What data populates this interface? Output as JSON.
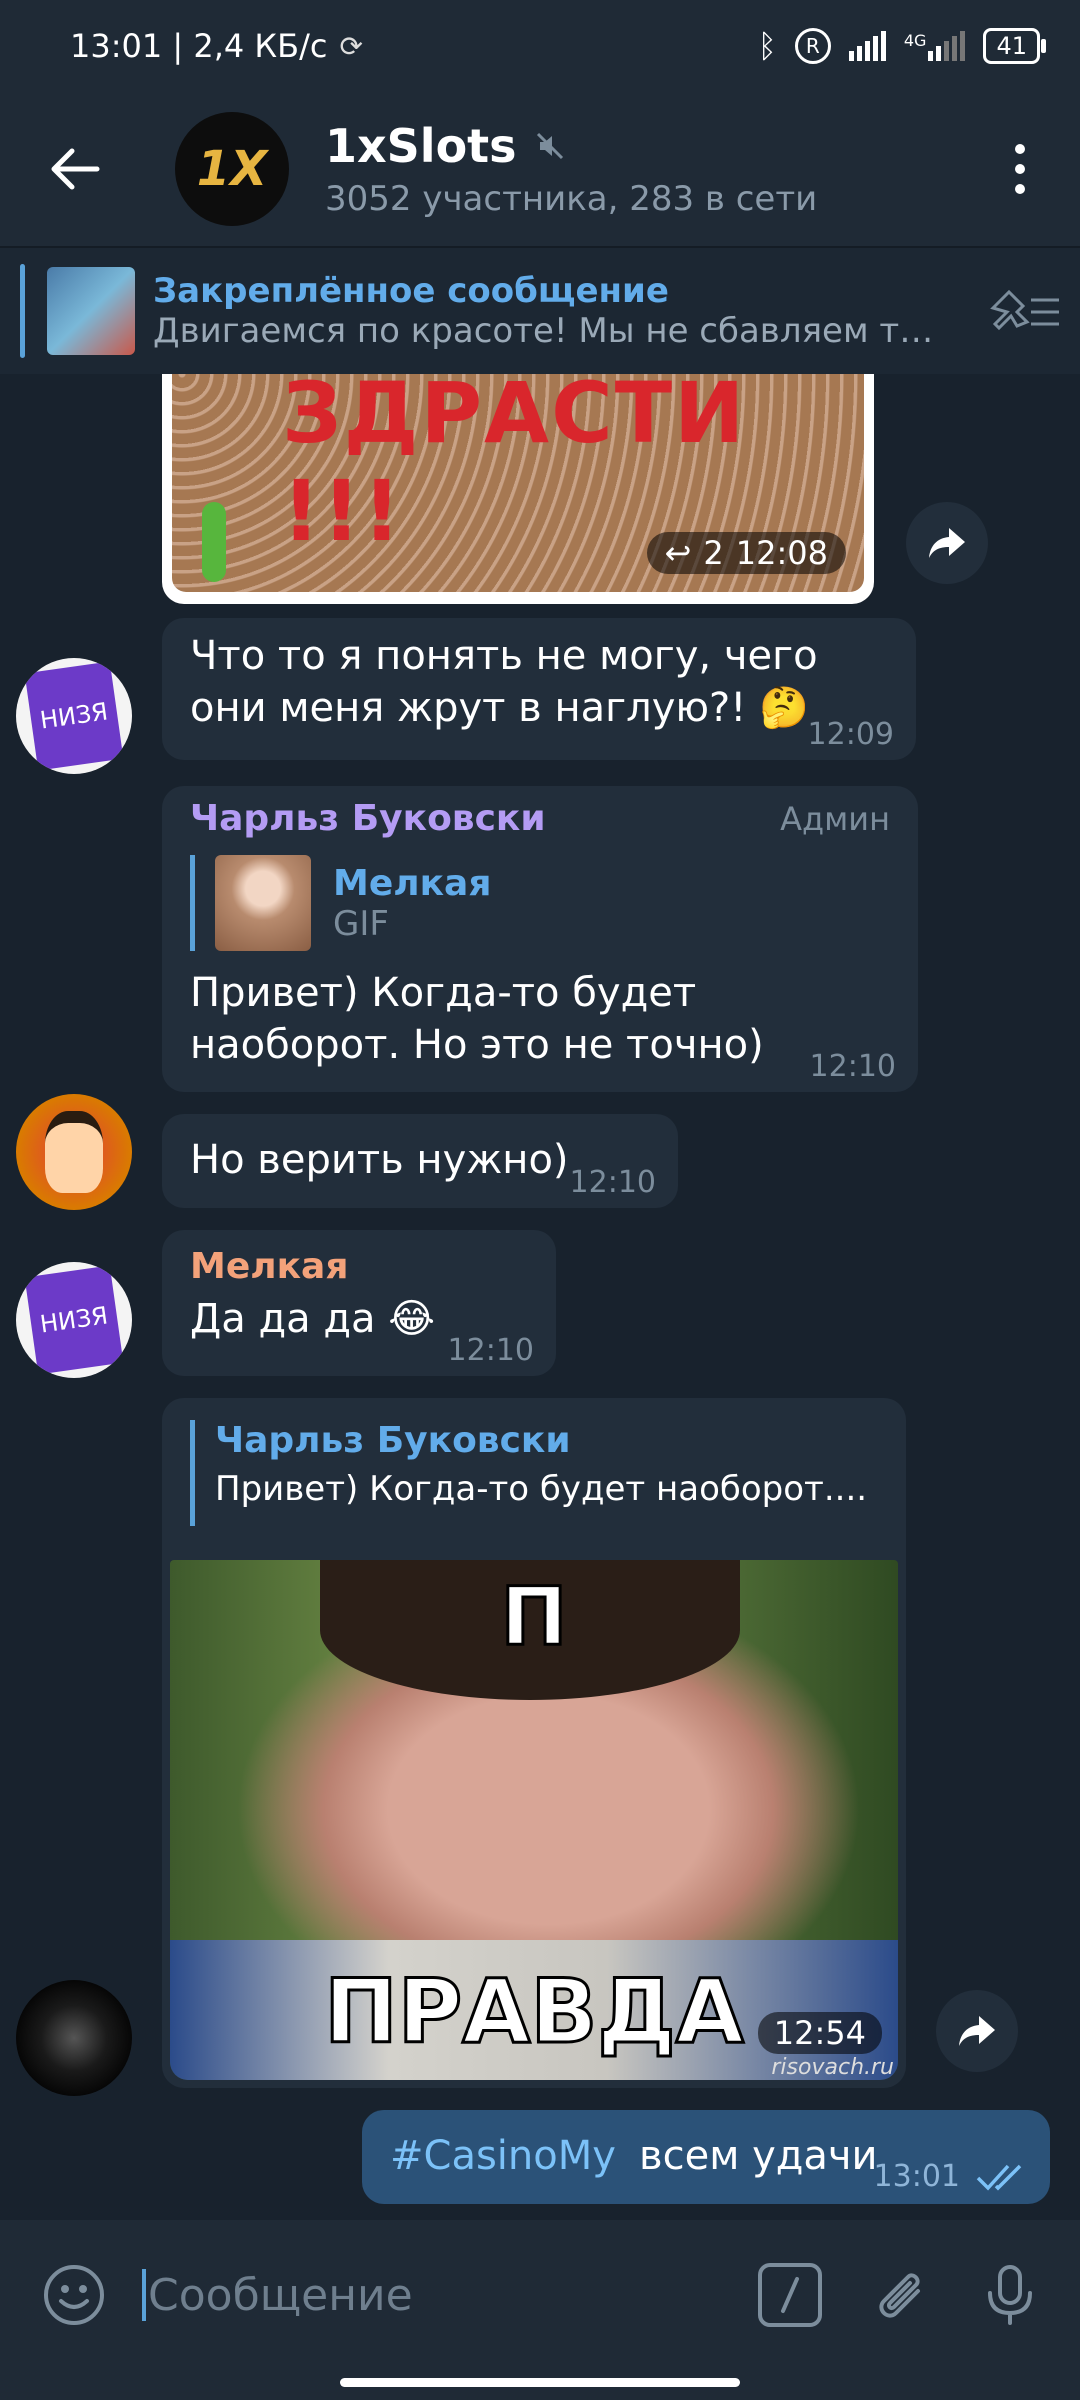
{
  "status": {
    "time_speed": "13:01 | 2,4 КБ/с",
    "network": "4G",
    "battery": "41"
  },
  "header": {
    "avatar_text": "1X",
    "title": "1xSlots",
    "subtitle": "3052 участника, 283 в сети",
    "muted_icon": "muted-icon"
  },
  "pinned": {
    "title": "Закреплённое сообщение",
    "body": "Двигаемся по красоте! Мы не сбавляем т…"
  },
  "messages": {
    "gif_top": {
      "overlay_text": "ЗДРАСТИ !!!",
      "replies": "2",
      "time": "12:08"
    },
    "m1": {
      "text": "Что то я понять не могу, чего они меня жрут в наглую?! 🤔",
      "time": "12:09"
    },
    "m2": {
      "sender": "Чарльз Буковски",
      "badge": "Админ",
      "reply_name": "Мелкая",
      "reply_text": "GIF",
      "text": "Привет) Когда-то будет наоборот. Но это не точно)",
      "time": "12:10"
    },
    "m3": {
      "text": "Но верить нужно)",
      "time": "12:10"
    },
    "m4": {
      "sender": "Мелкая",
      "text": "Да да да 😂",
      "time": "12:10"
    },
    "m5": {
      "reply_name": "Чарльз Буковски",
      "reply_text": "Привет) Когда-то будет наоборот....",
      "img_top": "П",
      "img_bottom": "ПРАВДА",
      "watermark": "risovach.ru",
      "time": "12:54"
    },
    "m6": {
      "hashtag": "#CasinoMy",
      "text": "всем удачи",
      "time": "13:01"
    }
  },
  "input": {
    "placeholder": "Сообщение"
  },
  "colors": {
    "accent": "#5aa2d9",
    "bg": "#18222d",
    "bubble": "#222e3b",
    "outgoing": "#2b5278"
  }
}
